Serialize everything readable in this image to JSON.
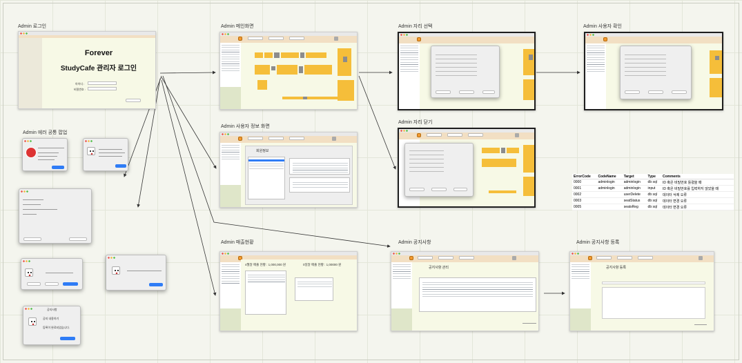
{
  "labels": {
    "login": "Admin 로그인",
    "popups": "Admin 에러 공통 팝업",
    "main": "Admin 메인화면",
    "user_info": "Admin 사용자 정보 화면",
    "sales": "Admin 매출현황",
    "seat_select": "Admin 자리 선택",
    "seat_close": "Admin 자리 닫기",
    "user_confirm": "Admin 사용자 확인",
    "notice": "Admin 공지사항",
    "notice_register": "Admin 공지사항 등록"
  },
  "login_screen": {
    "title_line1": "Forever",
    "title_line2": "StudyCafe 관리자 로그인",
    "id_label": "아이디 :",
    "pw_label": "비밀번호 :"
  },
  "sales_screen": {
    "month_sales": "4월달 매출 현황 : 1,000,000 원",
    "day_sales": "0일달 매출 현황 : 1,00000 원"
  },
  "user_screen": {
    "dialog_title": "회원정보"
  },
  "notice_screen": {
    "title": "공지사항 관리"
  },
  "notice_register_screen": {
    "title": "공지사항 등록"
  },
  "popup_texts": {
    "notice_title": "공지사항",
    "notice_line1": "공지 내용하기",
    "notice_line2": "등록이 완료되었습니다.",
    "confirm_label": "확인"
  },
  "error_table": {
    "headers": [
      "ErrorCode",
      "CodeName",
      "Target",
      "Type",
      "Comments"
    ],
    "rows": [
      [
        "0000",
        "adminlogin",
        "adminlogin",
        "db sql",
        "ID 혹은 비밀번호 틀렸을 때"
      ],
      [
        "0001",
        "adminlogin",
        "adminlogin",
        "input",
        "ID 혹은 비밀번호를 입력하지 않았을 때"
      ],
      [
        "0002",
        "",
        "userDelete",
        "db sql",
        "데이터 삭제 오류"
      ],
      [
        "0003",
        "",
        "seatStatus",
        "db sql",
        "데이터 변경 오류"
      ],
      [
        "0005",
        "",
        "seatsReg",
        "db sql",
        "데이터 변경 오류"
      ]
    ]
  },
  "colors": {
    "seat_yellow": "#f5be3a",
    "seat_gray": "#8c8c8c",
    "panel_bg": "#f7f9e6",
    "header_bg": "#f2dfc3",
    "accent_blue": "#2f7cf6"
  }
}
